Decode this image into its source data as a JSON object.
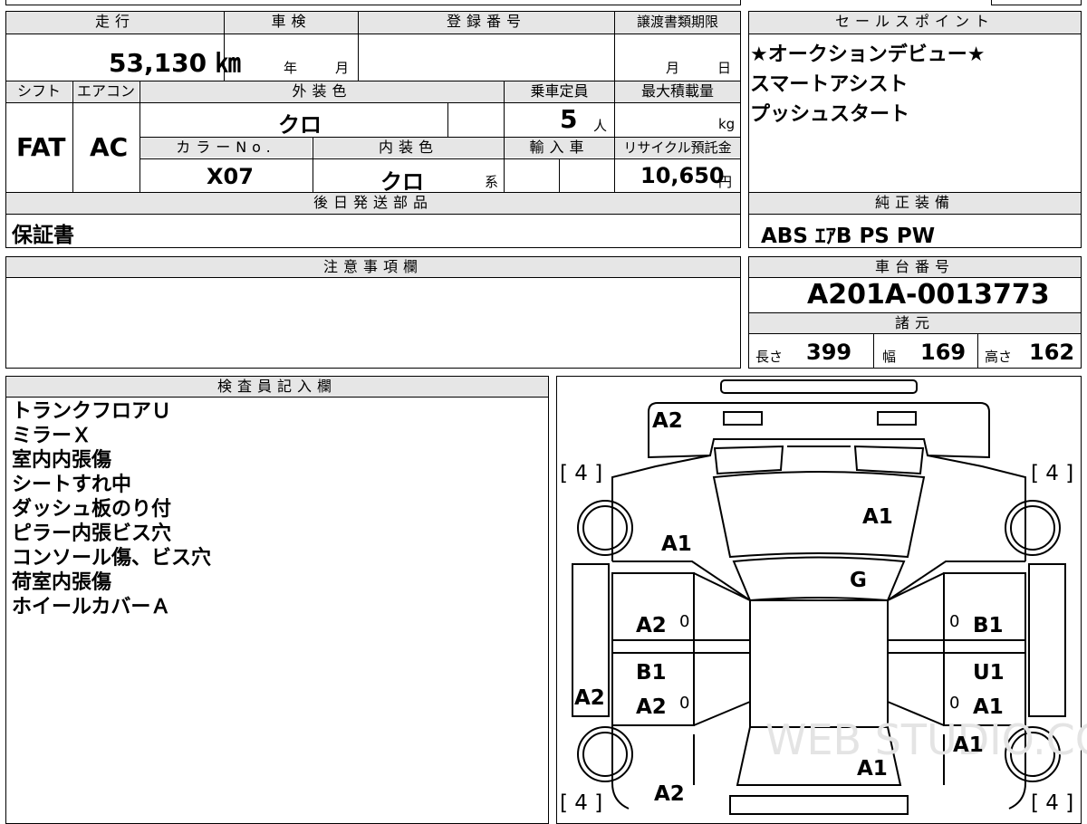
{
  "headers": {
    "mileage": "走行",
    "shaken": "車検",
    "registration": "登録番号",
    "transfer_deadline": "譲渡書類期限",
    "shift": "シフト",
    "aircon": "エアコン",
    "exterior_color": "外装色",
    "capacity": "乗車定員",
    "max_load": "最大積載量",
    "color_no": "カラーNo.",
    "interior_color": "内装色",
    "import": "輸入車",
    "recycle": "リサイクル預託金",
    "later_parts": "後日発送部品",
    "sales_point": "セールスポイント",
    "genuine_equipment": "純正装備",
    "notes": "注意事項欄",
    "chassis_no": "車台番号",
    "specs": "諸元",
    "inspector": "検査員記入欄"
  },
  "vehicle": {
    "mileage": "53,130 ㎞",
    "shaken_year_unit": "年",
    "shaken_month_unit": "月",
    "transfer_month_unit": "月",
    "transfer_day_unit": "日",
    "shift": "FAT",
    "aircon": "AC",
    "exterior_color": "クロ",
    "capacity": "5",
    "capacity_unit": "人",
    "max_load_unit": "kg",
    "color_no": "X07",
    "interior_color": "クロ",
    "interior_suffix": "系",
    "recycle": "10,650",
    "recycle_unit": "円",
    "later_parts": "保証書",
    "genuine_equipment": "ABS ｴｱB PS PW",
    "chassis_no": "A201A-0013773"
  },
  "specs": {
    "length_label": "長さ",
    "length": "399",
    "width_label": "幅",
    "width": "169",
    "height_label": "高さ",
    "height": "162"
  },
  "sales_points": [
    "★オークションデビュー★",
    "スマートアシスト",
    "プッシュスタート"
  ],
  "inspector_notes": [
    "トランクフロアＵ",
    "ミラーＸ",
    "室内内張傷",
    "シートすれ中",
    "ダッシュ板のり付",
    "ピラー内張ビス穴",
    "コンソール傷、ビス穴",
    "荷室内張傷",
    "ホイールカバーＡ"
  ],
  "diagram": {
    "tire_fl": "[ 4 ]",
    "tire_fr": "[ 4 ]",
    "tire_rl": "[ 4 ]",
    "tire_rr": "[ 4 ]",
    "front_bumper": "A2",
    "hood": "A1",
    "left_fender": "A1",
    "windshield": "G",
    "left_front_door": "A2",
    "right_front_door": "B1",
    "left_front_mirror_zero": "0",
    "right_front_mirror_zero": "0",
    "left_rear_door_top": "B1",
    "left_rear_door": "A2",
    "right_rear_door_top": "U1",
    "right_rear_door": "A1",
    "left_rear_zero": "0",
    "right_rear_zero": "0",
    "left_side": "A2",
    "right_quarter": "A1",
    "roof_rear": "A1",
    "rear_bumper": "A2",
    "watermark": "WEB STUDIO.CO"
  }
}
